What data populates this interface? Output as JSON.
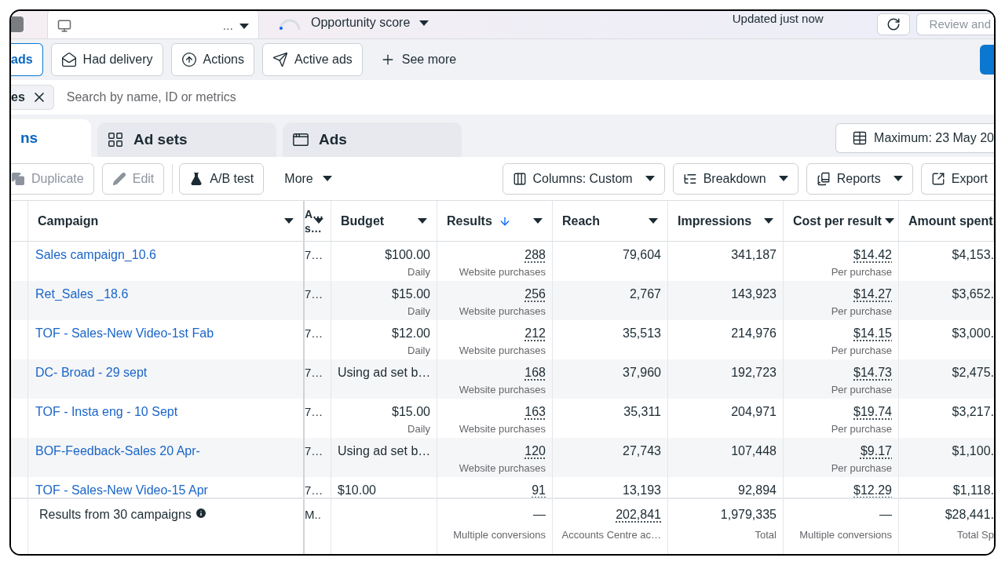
{
  "top_bar": {
    "account_selector": {
      "text": "..."
    },
    "opportunity_score": {
      "label": "Opportunity score"
    },
    "updated": "Updated just now",
    "review_button": "Review and"
  },
  "filters": [
    {
      "label": "ads",
      "selected": true
    },
    {
      "label": "Had delivery",
      "selected": false
    },
    {
      "label": "Actions",
      "selected": false
    },
    {
      "label": "Active ads",
      "selected": false
    },
    {
      "label": "See more",
      "selected": false
    }
  ],
  "search": {
    "chip": "es",
    "placeholder": "Search by name, ID or metrics"
  },
  "tabs": [
    {
      "label": "ns",
      "selected": true
    },
    {
      "label": "Ad sets",
      "selected": false
    },
    {
      "label": "Ads",
      "selected": false
    }
  ],
  "date_range": "Maximum: 23 May 20",
  "toolbar": {
    "left": [
      {
        "label": "Duplicate",
        "disabled": true
      },
      {
        "label": "Edit",
        "disabled": true
      },
      {
        "label": "A/B test",
        "disabled": false
      }
    ],
    "more": "More",
    "right": [
      {
        "label": "Columns: Custom",
        "kind": "dropdown"
      },
      {
        "label": "Breakdown",
        "kind": "dropdown"
      },
      {
        "label": "Reports",
        "kind": "dropdown"
      },
      {
        "label": "Export",
        "kind": "button"
      }
    ]
  },
  "table": {
    "columns": [
      {
        "lines": [
          "Campaign"
        ],
        "sorted": false
      },
      {
        "lines": [
          "A…",
          "s…"
        ],
        "sorted": false
      },
      {
        "lines": [
          "Budget"
        ],
        "sorted": false
      },
      {
        "lines": [
          "Results"
        ],
        "sorted": true
      },
      {
        "lines": [
          "Reach"
        ],
        "sorted": false
      },
      {
        "lines": [
          "Impressions"
        ],
        "sorted": false
      },
      {
        "lines": [
          "Cost per result"
        ],
        "sorted": false
      },
      {
        "lines": [
          "Amount spent"
        ],
        "sorted": false
      }
    ],
    "rows": [
      {
        "campaign": "Sales campaign_10.6",
        "col_2": "7…",
        "budget": {
          "value": "$100.00",
          "sub": "Daily"
        },
        "results": {
          "value": "288",
          "sub": "Website purchases"
        },
        "reach": "79,604",
        "impressions": "341,187",
        "cost_per_result": {
          "value": "$14.42",
          "sub": "Per purchase"
        },
        "amount_spent": "$4,153."
      },
      {
        "campaign": "Ret_Sales _18.6",
        "col_2": "7…",
        "budget": {
          "value": "$15.00",
          "sub": "Daily"
        },
        "results": {
          "value": "256",
          "sub": "Website purchases"
        },
        "reach": "2,767",
        "impressions": "143,923",
        "cost_per_result": {
          "value": "$14.27",
          "sub": "Per purchase"
        },
        "amount_spent": "$3,652."
      },
      {
        "campaign": "TOF - Sales-New Video-1st Fab",
        "col_2": "7…",
        "budget": {
          "value": "$12.00",
          "sub": "Daily"
        },
        "results": {
          "value": "212",
          "sub": "Website purchases"
        },
        "reach": "35,513",
        "impressions": "214,976",
        "cost_per_result": {
          "value": "$14.15",
          "sub": "Per purchase"
        },
        "amount_spent": "$3,000."
      },
      {
        "campaign": "DC- Broad - 29 sept",
        "col_2": "7…",
        "budget": {
          "value": "Using ad set b…"
        },
        "results": {
          "value": "168",
          "sub": "Website purchases"
        },
        "reach": "37,960",
        "impressions": "192,723",
        "cost_per_result": {
          "value": "$14.73",
          "sub": "Per purchase"
        },
        "amount_spent": "$2,475."
      },
      {
        "campaign": "TOF - Insta eng - 10 Sept",
        "col_2": "7…",
        "budget": {
          "value": "$15.00",
          "sub": "Daily"
        },
        "results": {
          "value": "163",
          "sub": "Website purchases"
        },
        "reach": "35,311",
        "impressions": "204,971",
        "cost_per_result": {
          "value": "$19.74",
          "sub": "Per purchase"
        },
        "amount_spent": "$3,217."
      },
      {
        "campaign": "BOF-Feedback-Sales 20 Apr-",
        "col_2": "7…",
        "budget": {
          "value": "Using ad set b…"
        },
        "results": {
          "value": "120",
          "sub": "Website purchases"
        },
        "reach": "27,743",
        "impressions": "107,448",
        "cost_per_result": {
          "value": "$9.17",
          "sub": "Per purchase"
        },
        "amount_spent": "$1,100."
      },
      {
        "campaign": "TOF - Sales-New Video-15 Apr",
        "col_2": "7…",
        "budget": {
          "value": "$10.00"
        },
        "results": {
          "value": "91"
        },
        "reach": "13,193",
        "impressions": "92,894",
        "cost_per_result": {
          "value": "$12.29"
        },
        "amount_spent": "$1,118."
      }
    ],
    "footer": {
      "label": "Results from 30 campaigns",
      "col_2": "M..",
      "results": {
        "value": "—",
        "sub": "Multiple conversions",
        "dotted": false
      },
      "reach": {
        "value": "202,841",
        "sub": "Accounts Centre ac…",
        "dotted": true
      },
      "impressions": {
        "value": "1,979,335",
        "sub": "Total",
        "dotted": false
      },
      "cost_per_result": {
        "value": "—",
        "sub": "Multiple conversions",
        "dotted": false
      },
      "amount_spent": {
        "value": "$28,441.",
        "sub": "Total Sp",
        "dotted": false
      }
    }
  }
}
